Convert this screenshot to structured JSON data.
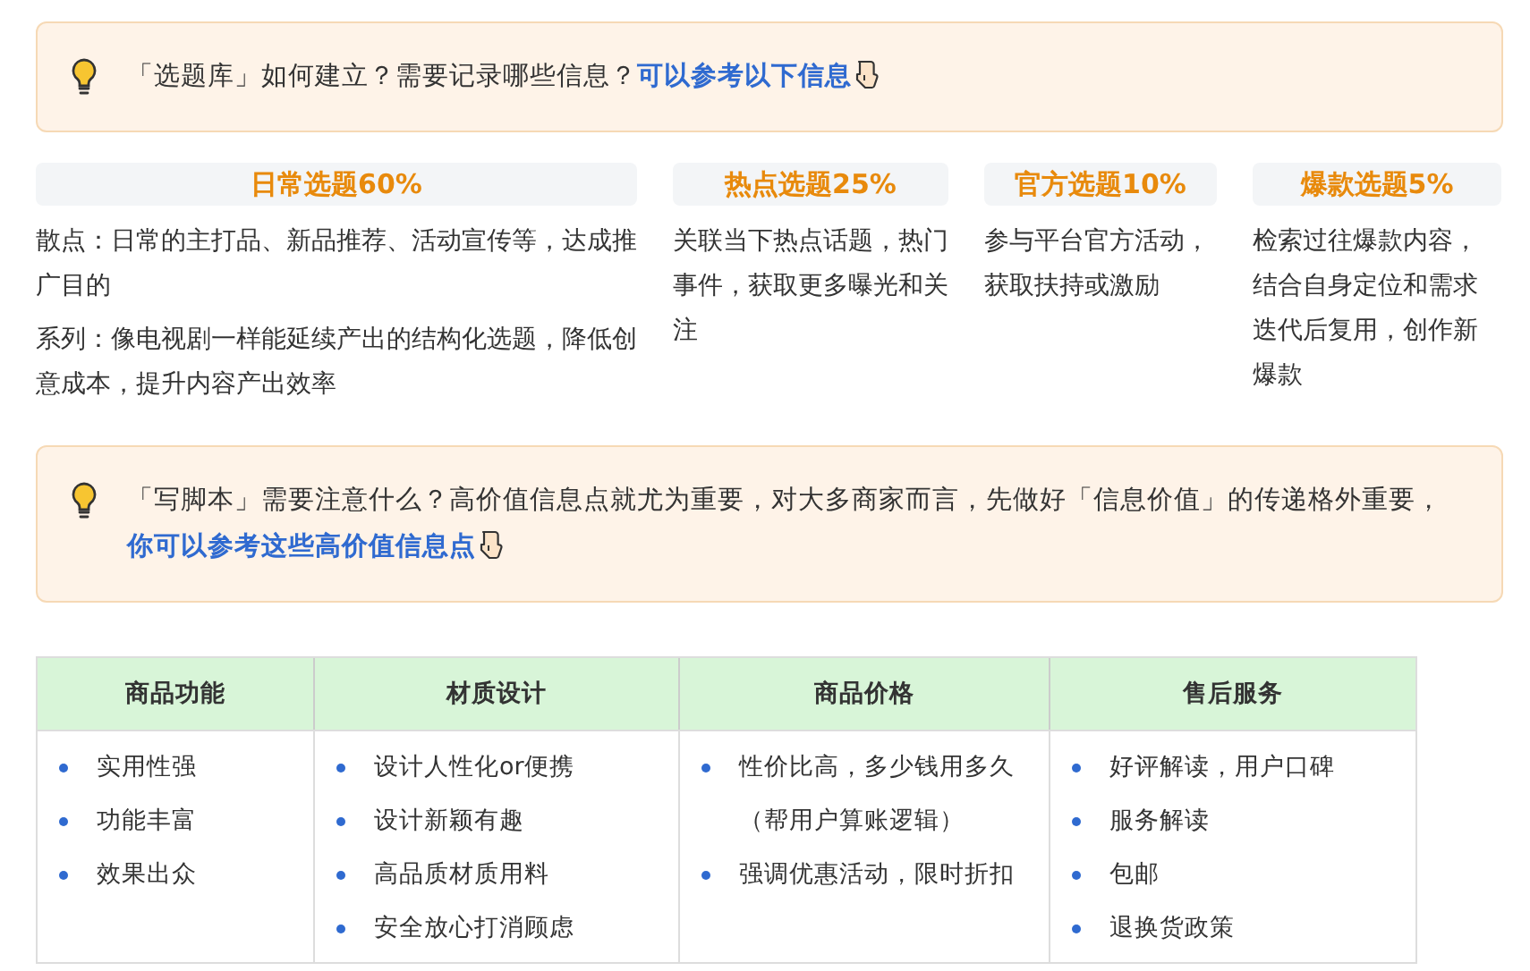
{
  "callouts": [
    {
      "text": "「选题库」如何建立？需要记录哪些信息？",
      "link": "可以参考以下信息"
    },
    {
      "text": "「写脚本」需要注意什么？高价值信息点就尤为重要，对大多商家而言，先做好「信息价值」的传递格外重要，",
      "link": "你可以参考这些高价值信息点"
    }
  ],
  "topic_types": [
    {
      "title": "日常选题60%",
      "paragraphs": [
        "散点：日常的主打品、新品推荐、活动宣传等，达成推广目的",
        "系列：像电视剧一样能延续产出的结构化选题，降低创意成本，提升内容产出效率"
      ]
    },
    {
      "title": "热点选题25%",
      "paragraphs": [
        "关联当下热点话题，热门事件，获取更多曝光和关注"
      ]
    },
    {
      "title": "官方选题10%",
      "paragraphs": [
        "参与平台官方活动，获取扶持或激励"
      ]
    },
    {
      "title": "爆款选题5%",
      "paragraphs": [
        "检索过往爆款内容，结合自身定位和需求迭代后复用，创作新爆款"
      ]
    }
  ],
  "table": {
    "columns": [
      {
        "heading": "商品功能",
        "items": [
          "实用性强",
          "功能丰富",
          "效果出众"
        ]
      },
      {
        "heading": "材质设计",
        "items": [
          "设计人性化or便携",
          "设计新颖有趣",
          "高品质材质用料",
          "安全放心打消顾虑"
        ]
      },
      {
        "heading": "商品价格",
        "items": [
          "性价比高，多少钱用多久（帮用户算账逻辑）",
          "强调优惠活动，限时折扣"
        ]
      },
      {
        "heading": "售后服务",
        "items": [
          "好评解读，用户口碑",
          "服务解读",
          "包邮",
          "退换货政策"
        ]
      }
    ]
  }
}
